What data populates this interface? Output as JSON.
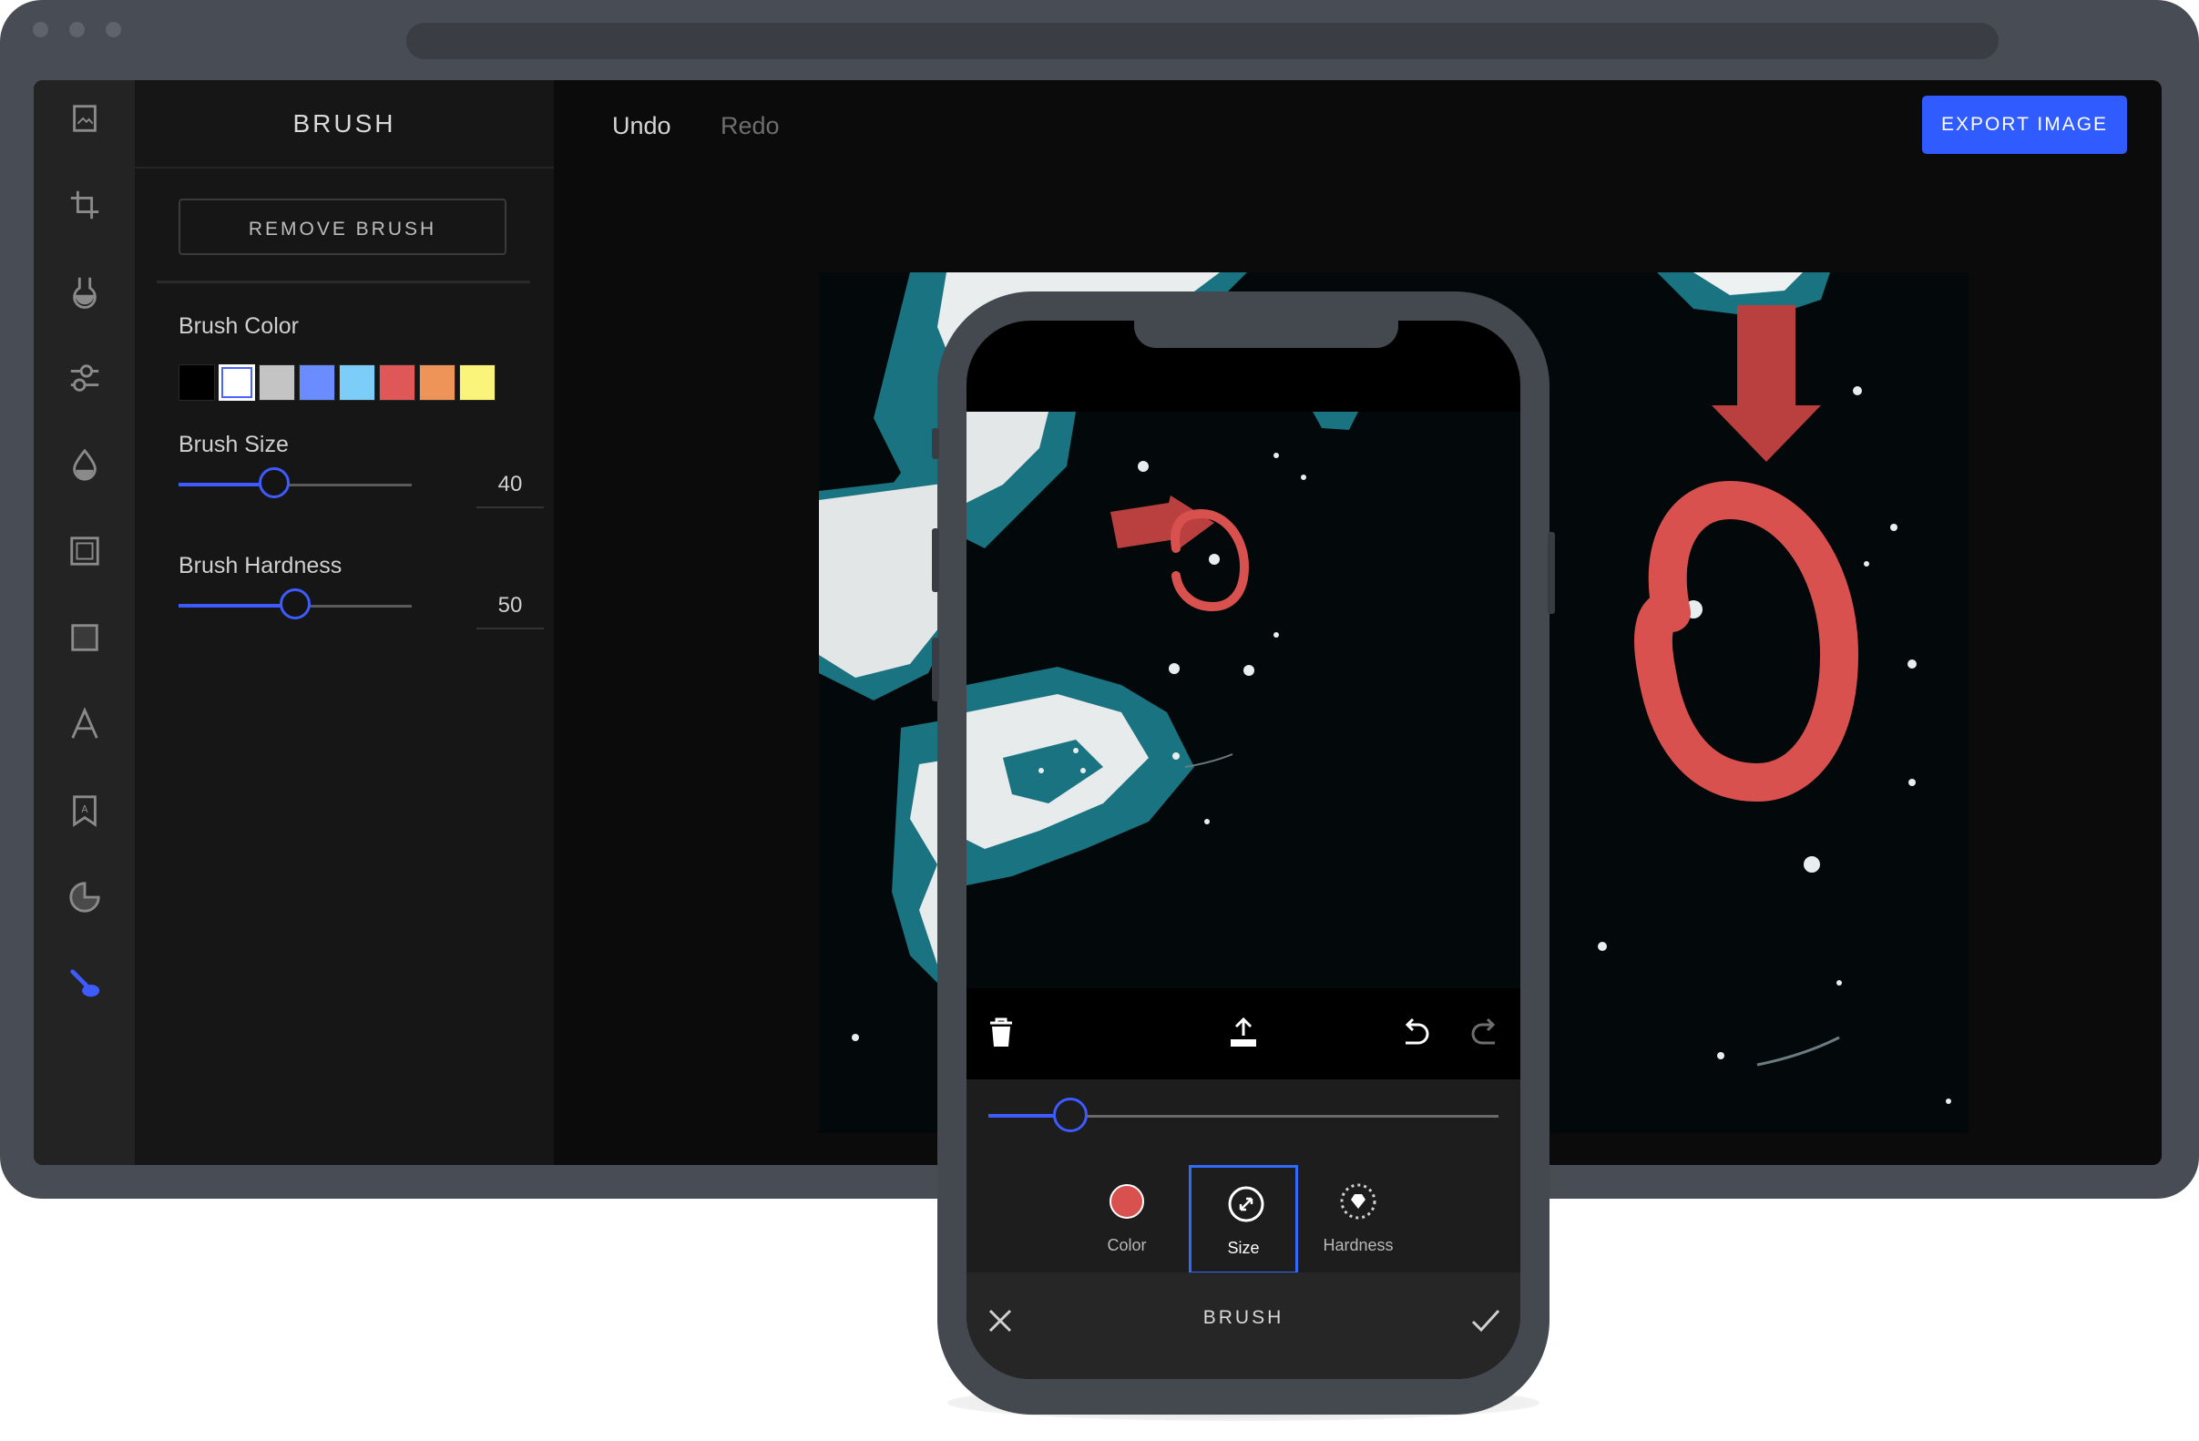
{
  "panel": {
    "title": "BRUSH",
    "remove_label": "REMOVE BRUSH",
    "color_label": "Brush Color",
    "colors": [
      "#000000",
      "#ffffff",
      "#c4c4c4",
      "#6b8cff",
      "#7ccdf7",
      "#e05757",
      "#ee9459",
      "#fbf47b"
    ],
    "selected_color_index": 1,
    "size_label": "Brush Size",
    "size_value": "40",
    "size_fraction": 0.41,
    "hardness_label": "Brush Hardness",
    "hardness_value": "50",
    "hardness_fraction": 0.5
  },
  "toolbar": {
    "undo": "Undo",
    "redo": "Redo",
    "export": "EXPORT IMAGE"
  },
  "rail_icons": [
    "image-icon",
    "crop-icon",
    "filter-icon",
    "adjust-icon",
    "drop-icon",
    "frame-icon",
    "overlay-icon",
    "text-icon",
    "sticker-icon",
    "focus-icon",
    "brush-icon"
  ],
  "colors": {
    "accent": "#2f5bff",
    "brush": "#d9514e",
    "ice": "#e8ecec",
    "teal": "#1e7a86"
  },
  "phone": {
    "tools": [
      {
        "label": "Color",
        "icon": "color-dot-icon"
      },
      {
        "label": "Size",
        "icon": "size-icon"
      },
      {
        "label": "Hardness",
        "icon": "hardness-icon"
      }
    ],
    "active_tool_index": 1,
    "slider_fraction": 0.16,
    "title": "BRUSH",
    "action_icons": [
      "trash-icon",
      "upload-icon",
      "undo-icon",
      "redo-icon"
    ]
  }
}
